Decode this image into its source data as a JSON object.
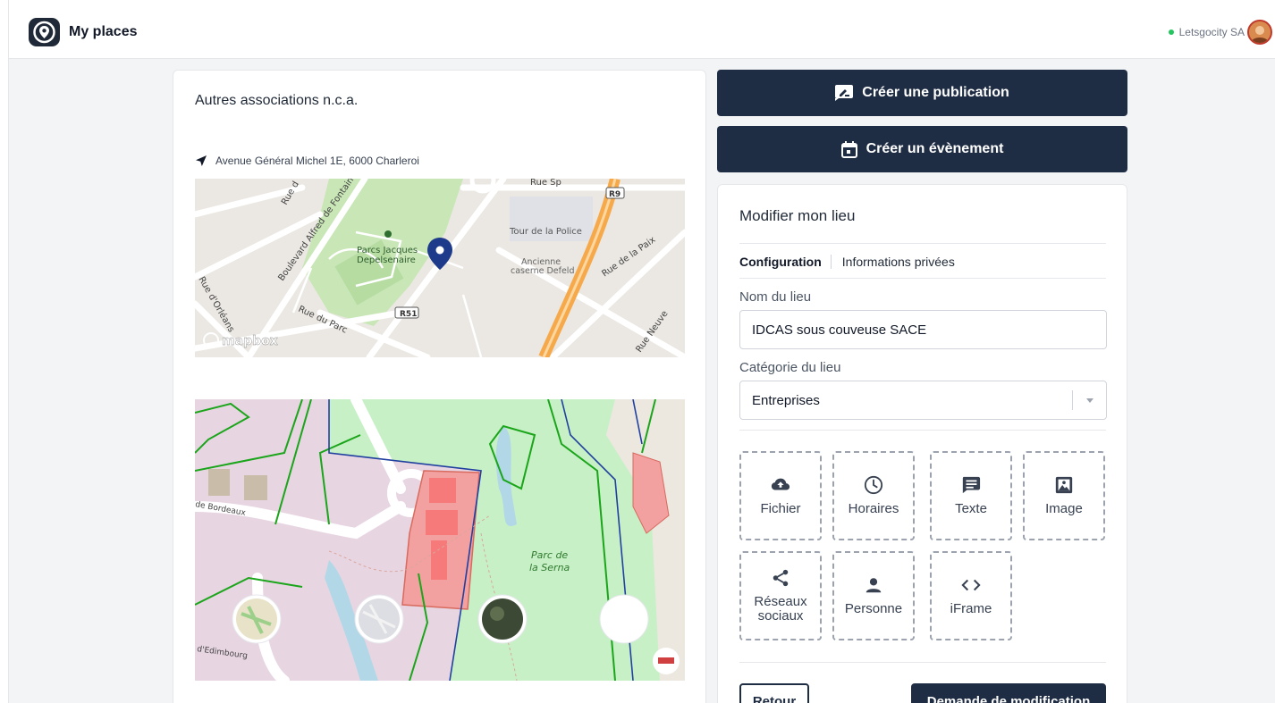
{
  "app": {
    "title": "My places"
  },
  "user": {
    "name": "Letsgocity SA",
    "status_color": "#22c55e"
  },
  "place": {
    "category_text": "Autres associations n.c.a.",
    "address": "Avenue Général Michel 1E, 6000 Charleroi"
  },
  "map1": {
    "labels": {
      "park": "Parcs Jacques",
      "park2": "Depelsenaire",
      "police": "Tour de la Police",
      "caserne": "Ancienne",
      "caserne2": "caserne Defeld",
      "r51": "R51",
      "r9": "R9",
      "boulevard": "Boulevard Alfred de Fontaine",
      "rue_paix": "Rue de la Paix",
      "rue_parc": "Rue du Parc",
      "rue_orleans": "Rue d'Orléans",
      "rue_neuve": "Rue Neuve",
      "rue_sp": "Rue Sp",
      "rue_top": "Rue d",
      "mapbox": "mapbox"
    }
  },
  "map2": {
    "labels": {
      "parc": "Parc de",
      "parc2": "la Serna",
      "bordeaux": "de Bordeaux",
      "edimbourg": "d'Edimbourg"
    }
  },
  "actions": {
    "create_publication": "Créer une publication",
    "create_event": "Créer un évènement"
  },
  "edit": {
    "title": "Modifier mon lieu",
    "tabs": [
      "Configuration",
      "Informations privées"
    ],
    "name_label": "Nom du lieu",
    "name_value": "IDCAS sous couveuse SACE",
    "category_label": "Catégorie du lieu",
    "category_value": "Entreprises",
    "blocks": [
      {
        "label": "Fichier",
        "icon": "cloud-upload-icon"
      },
      {
        "label": "Horaires",
        "icon": "clock-icon"
      },
      {
        "label": "Texte",
        "icon": "message-icon"
      },
      {
        "label": "Image",
        "icon": "image-icon"
      },
      {
        "label": "Réseaux sociaux",
        "icon": "share-icon"
      },
      {
        "label": "Personne",
        "icon": "person-icon"
      },
      {
        "label": "iFrame",
        "icon": "code-icon"
      }
    ],
    "back_label": "Retour",
    "request_label": "Demande de modification"
  },
  "colors": {
    "primary": "#1f2d44",
    "park_green": "#c9eac0",
    "zone_red": "#f3a0a0"
  }
}
